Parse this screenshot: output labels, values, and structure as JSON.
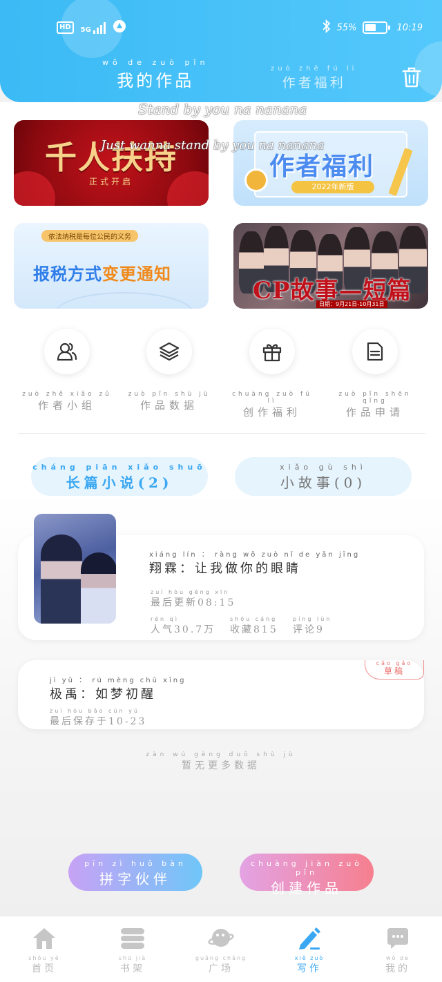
{
  "status_bar": {
    "network": "HD",
    "signal": "5G",
    "battery": "55%",
    "battery_level": 0.55,
    "time": "10:19"
  },
  "header": {
    "tabs": [
      {
        "pinyin": "wǒ de zuò pǐn",
        "label": "我的作品",
        "active": true
      },
      {
        "pinyin": "zuò zhě fú lì",
        "label": "作者福利",
        "active": false
      }
    ],
    "trash_icon": "trash-icon"
  },
  "lyrics": [
    "Stand by you na nanana",
    "Just wanna stand by you na nanana"
  ],
  "banners": [
    {
      "title": "千人扶持",
      "subtitle": "正式开启"
    },
    {
      "title": "作者福利",
      "subtitle": "2022年新版"
    },
    {
      "tag": "依法纳税是每位公民的义务",
      "title_a": "报税方式",
      "title_b": "变更通知"
    },
    {
      "title": "CP故事—短篇征文",
      "date": "日期：9月21日-10月31日"
    }
  ],
  "quick_actions": [
    {
      "pinyin": "zuò zhě xiǎo zǔ",
      "label": "作者小组",
      "icon": "users-icon"
    },
    {
      "pinyin": "zuò pǐn shù jù",
      "label": "作品数据",
      "icon": "layers-icon"
    },
    {
      "pinyin": "chuàng zuò fú lì",
      "label": "创作福利",
      "icon": "gift-icon"
    },
    {
      "pinyin": "zuò pǐn shēn qǐng",
      "label": "作品申请",
      "icon": "document-icon"
    }
  ],
  "segments": [
    {
      "pinyin": "cháng piān xiǎo shuō",
      "label": "长篇小说(2)",
      "active": true
    },
    {
      "pinyin": "xiǎo gù shì",
      "label": "小故事(0)",
      "active": false
    }
  ],
  "works": [
    {
      "title_pinyin": "xiáng lín ： ràng wǒ zuò nǐ de yǎn jīng",
      "title": "翔霖：让我做你的眼睛",
      "updated_pinyin": "zuì hòu gēng xīn",
      "updated": "最后更新08:15",
      "pop_pinyin": "rén qì",
      "popularity": "人气30.7万",
      "fav_pinyin": "shōu cáng",
      "favorites": "收藏815",
      "com_pinyin": "píng lùn",
      "comments": "评论9"
    },
    {
      "title_pinyin": "jì yǔ ： rú mèng chū xǐng",
      "title": "极禹：如梦初醒",
      "saved_pinyin": "zuì hòu bǎo cún yú",
      "saved": "最后保存于10-23",
      "badge_pinyin": "cǎo gǎo",
      "badge": "草稿"
    }
  ],
  "no_more": {
    "pinyin": "zàn wú gèng duō shù jù",
    "label": "暂无更多数据"
  },
  "actions": [
    {
      "pinyin": "pīn zì huǒ bàn",
      "label": "拼字伙伴"
    },
    {
      "pinyin": "chuàng jiàn zuò pǐn",
      "label": "创建作品"
    }
  ],
  "bottom_nav": [
    {
      "pinyin": "shǒu yè",
      "label": "首页",
      "icon": "home-icon",
      "active": false
    },
    {
      "pinyin": "shū jià",
      "label": "书架",
      "icon": "bookshelf-icon",
      "active": false
    },
    {
      "pinyin": "guǎng chǎng",
      "label": "广场",
      "icon": "planet-icon",
      "active": false
    },
    {
      "pinyin": "xiě zuò",
      "label": "写作",
      "icon": "pen-icon",
      "active": true
    },
    {
      "pinyin": "wǒ de",
      "label": "我的",
      "icon": "chat-icon",
      "active": false
    }
  ],
  "colors": {
    "primary": "#3aa7f2",
    "header": "#48c1f8",
    "draft": "#e86c6a"
  }
}
